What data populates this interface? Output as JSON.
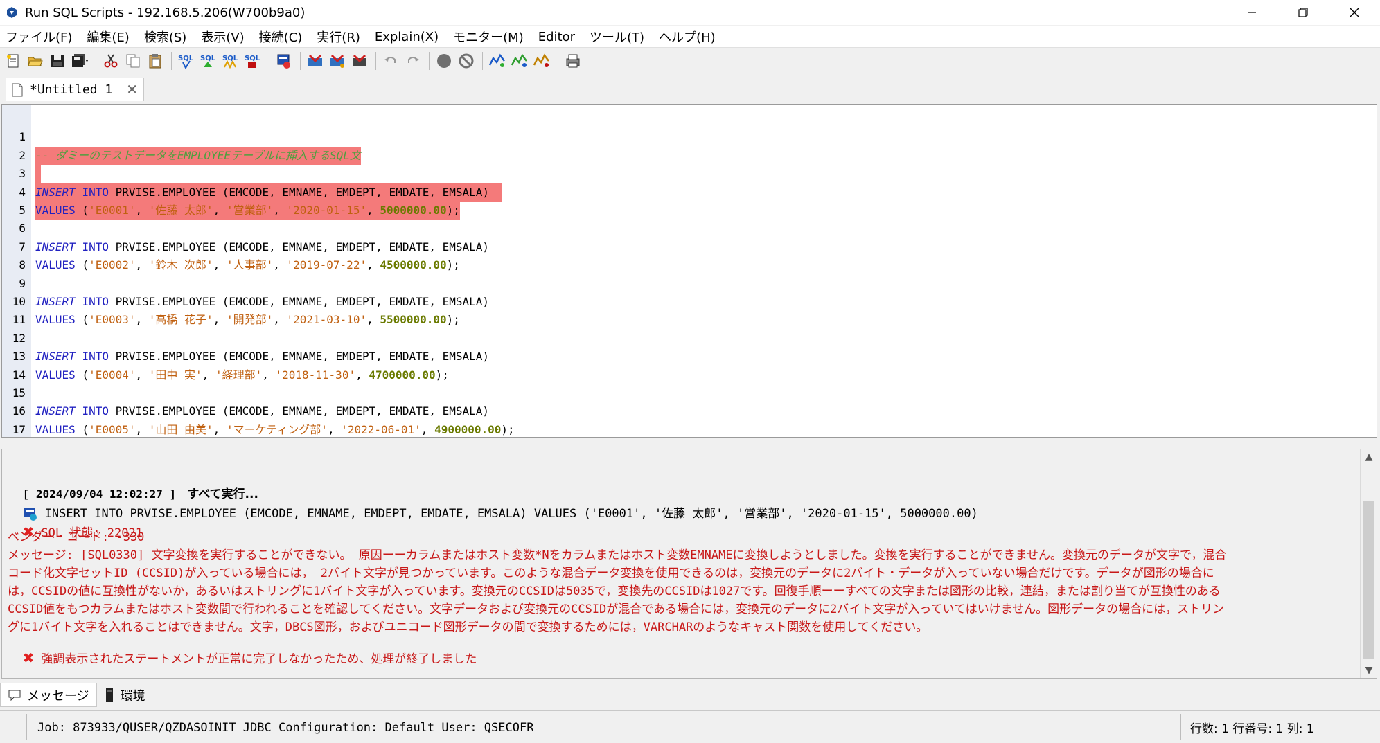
{
  "window": {
    "title": "Run SQL Scripts - 192.168.5.206(W700b9a0)"
  },
  "menu": [
    "ファイル(F)",
    "編集(E)",
    "検索(S)",
    "表示(V)",
    "接続(C)",
    "実行(R)",
    "Explain(X)",
    "モニター(M)",
    "Editor",
    "ツール(T)",
    "ヘルプ(H)"
  ],
  "tab": {
    "label": "*Untitled 1"
  },
  "editor": {
    "line_numbers": [
      "1",
      "2",
      "3",
      "4",
      "5",
      "6",
      "7",
      "8",
      "9",
      "10",
      "11",
      "12",
      "13",
      "14",
      "15",
      "16",
      "17"
    ],
    "comment": "-- ダミーのテストデータをEMPLOYEEテーブルに挿入するSQL文",
    "kw_insert": "INSERT",
    "kw_into": "INTO",
    "kw_values": "VALUES",
    "insert_cols": " PRVISE.EMPLOYEE (EMCODE, EMNAME, EMDEPT, EMDATE, EMSALA)",
    "rows": [
      {
        "code": "'E0001'",
        "name": "'佐藤 太郎'",
        "dept": "'営業部'",
        "date": "'2020-01-15'",
        "salary": "5000000.00"
      },
      {
        "code": "'E0002'",
        "name": "'鈴木 次郎'",
        "dept": "'人事部'",
        "date": "'2019-07-22'",
        "salary": "4500000.00"
      },
      {
        "code": "'E0003'",
        "name": "'高橋 花子'",
        "dept": "'開発部'",
        "date": "'2021-03-10'",
        "salary": "5500000.00"
      },
      {
        "code": "'E0004'",
        "name": "'田中 実'",
        "dept": "'経理部'",
        "date": "'2018-11-30'",
        "salary": "4700000.00"
      },
      {
        "code": "'E0005'",
        "name": "'山田 由美'",
        "dept": "'マーケティング部'",
        "date": "'2022-06-01'",
        "salary": "4900000.00"
      }
    ]
  },
  "messages": {
    "timestamp": "[ 2024/09/04 12:02:27 ]",
    "run_all": "すべて実行...",
    "statement": "INSERT INTO PRVISE.EMPLOYEE (EMCODE, EMNAME, EMDEPT, EMDATE, EMSALA) VALUES ('E0001', '佐藤 太郎', '営業部', '2020-01-15', 5000000.00)",
    "sql_state": "SQL 状態: 22021",
    "vendor_code": "ベンダー・コード: -330",
    "message_lines": [
      "メッセージ: [SQL0330] 文字変換を実行することができない。 原因ーーカラムまたはホスト変数*Nをカラムまたはホスト変数EMNAMEに変換しようとしました。変換を実行することができません。変換元のデータが文字で，混合",
      "コード化文字セットID (CCSID)が入っている場合には， 2バイト文字が見つかっています。このような混合データ変換を使用できるのは，変換元のデータに2バイト・データが入っていない場合だけです。データが図形の場合に",
      "は，CCSIDの値に互換性がないか，あるいはストリングに1バイト文字が入っています。変換元のCCSIDは5035で，変換先のCCSIDは1027です。回復手順ーーすべての文字または図形の比較，連結，または割り当てが互換性のある",
      "CCSID値をもつカラムまたはホスト変数間で行われることを確認してください。文字データおよび変換元のCCSIDが混合である場合には，変換元のデータに2バイト文字が入っていてはいけません。図形データの場合には，ストリン",
      "グに1バイト文字を入れることはできません。文字，DBCS図形，およびユニコード図形データの間で変換するためには，VARCHARのようなキャスト関数を使用してください。"
    ],
    "final_error": "強調表示されたステートメントが正常に完了しなかったため、処理が終了しました"
  },
  "bottom_tabs": {
    "messages": "メッセージ",
    "environment": "環境"
  },
  "status": {
    "job": "Job: 873933/QUSER/QZDASOINIT  JDBC Configuration: Default  User: QSECOFR",
    "position": "行数: 1  行番号: 1  列: 1"
  },
  "colors": {
    "highlight": "#f47a7a",
    "keyword": "#2020c0",
    "string": "#c06010",
    "number": "#6a7a00",
    "comment": "#4f9f3f",
    "error": "#c81818"
  }
}
